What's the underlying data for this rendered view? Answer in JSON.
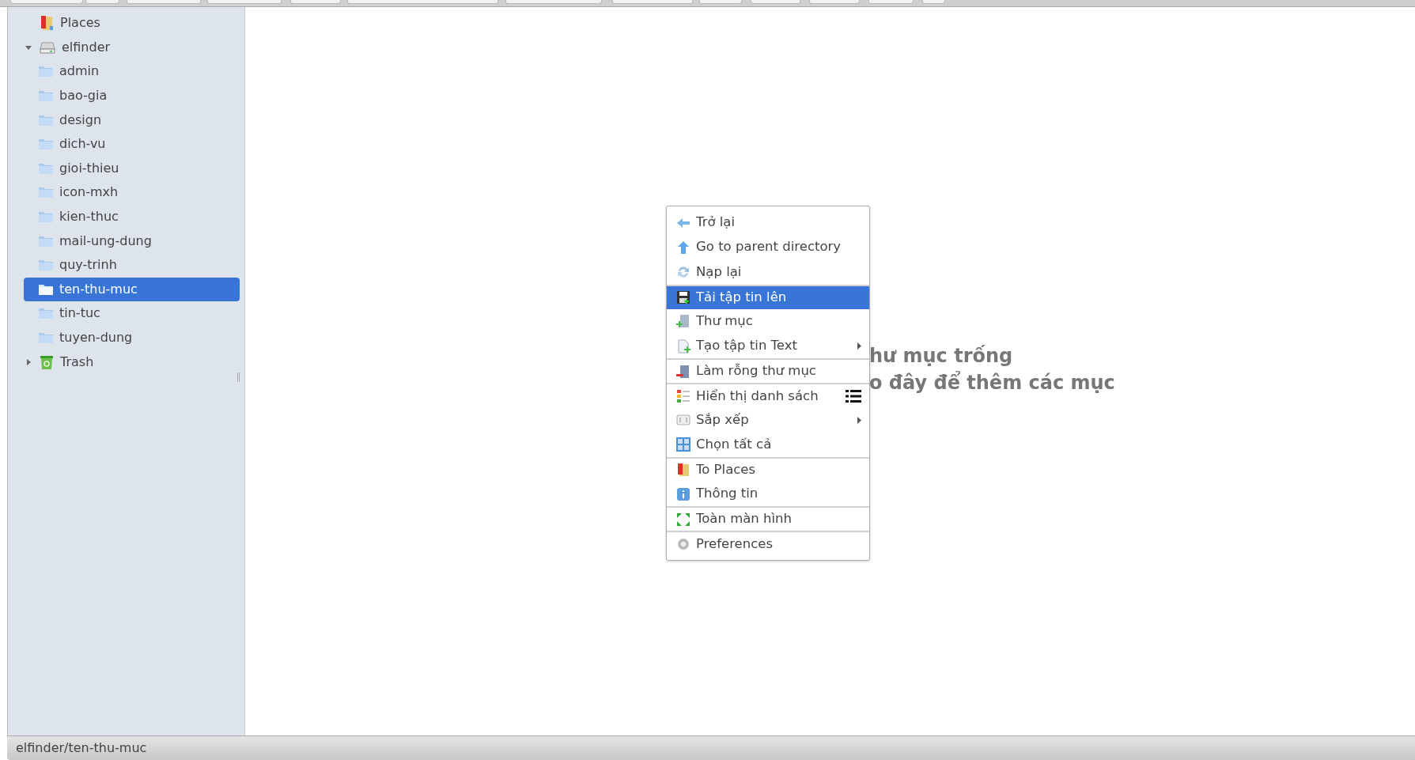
{
  "sidebar": {
    "tree": [
      {
        "label": "Places",
        "selected": false
      },
      {
        "label": "elfinder",
        "expanded": true,
        "has_children": true,
        "selected": false,
        "children": [
          {
            "label": "admin",
            "selected": false
          },
          {
            "label": "bao-gia",
            "selected": false
          },
          {
            "label": "design",
            "selected": false
          },
          {
            "label": "dich-vu",
            "selected": false
          },
          {
            "label": "gioi-thieu",
            "selected": false
          },
          {
            "label": "icon-mxh",
            "selected": false
          },
          {
            "label": "kien-thuc",
            "selected": false
          },
          {
            "label": "mail-ung-dung",
            "selected": false
          },
          {
            "label": "quy-trinh",
            "selected": false
          },
          {
            "label": "ten-thu-muc",
            "selected": true
          },
          {
            "label": "tin-tuc",
            "selected": false
          },
          {
            "label": "tuyen-dung",
            "selected": false
          }
        ]
      },
      {
        "label": "Trash",
        "expanded": false,
        "has_children": true,
        "selected": false
      }
    ]
  },
  "empty_message": {
    "lines": [
      "hư mục trống",
      "o đây để thêm các mục"
    ]
  },
  "context_menu": {
    "items": [
      {
        "label": "Trở lại",
        "selected": false,
        "separator_before": false,
        "submenu": false
      },
      {
        "label": "Go to parent directory",
        "selected": false,
        "separator_before": false,
        "submenu": false
      },
      {
        "label": "Nạp lại",
        "selected": false,
        "separator_before": false,
        "submenu": false
      },
      {
        "label": "Tải tập tin lên",
        "selected": true,
        "separator_before": true,
        "submenu": false
      },
      {
        "label": "Thư mục",
        "selected": false,
        "separator_before": false,
        "submenu": false
      },
      {
        "label": "Tạo tập tin Text",
        "selected": false,
        "separator_before": false,
        "submenu": true
      },
      {
        "label": "Làm rỗng thư mục",
        "selected": false,
        "separator_before": true,
        "submenu": false
      },
      {
        "label": "Hiển thị danh sách",
        "selected": false,
        "separator_before": true,
        "submenu": false,
        "shortcut_icon": true
      },
      {
        "label": "Sắp xếp",
        "selected": false,
        "separator_before": false,
        "submenu": true
      },
      {
        "label": "Chọn tất cả",
        "selected": false,
        "separator_before": false,
        "submenu": false
      },
      {
        "label": "To Places",
        "selected": false,
        "separator_before": true,
        "submenu": false
      },
      {
        "label": "Thông tin",
        "selected": false,
        "separator_before": false,
        "submenu": false
      },
      {
        "label": "Toàn màn hình",
        "selected": false,
        "separator_before": true,
        "submenu": false
      },
      {
        "label": "Preferences",
        "selected": false,
        "separator_before": true,
        "submenu": false
      }
    ]
  },
  "status_bar": {
    "path": "elfinder/ten-thu-muc"
  }
}
